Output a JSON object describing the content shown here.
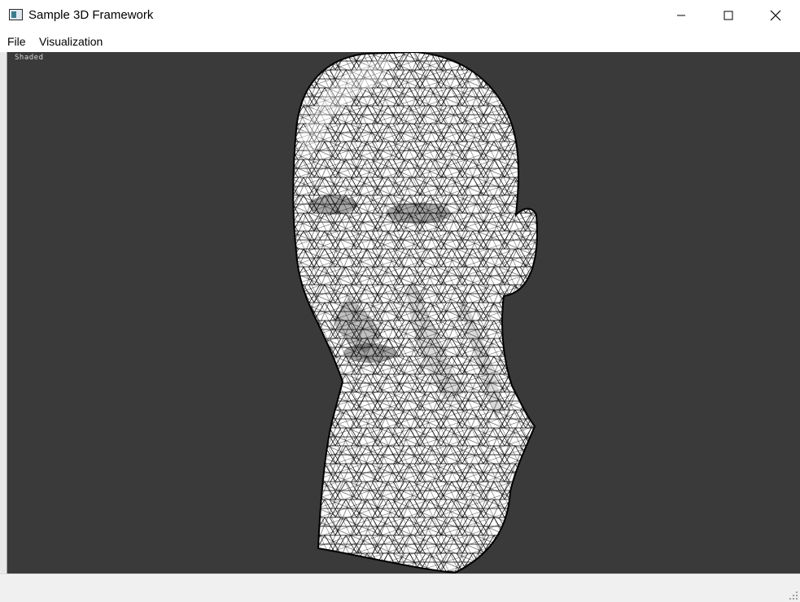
{
  "window": {
    "title": "Sample 3D Framework",
    "icons": {
      "app": "app-window-icon",
      "minimize": "minimize-icon",
      "maximize": "maximize-icon",
      "close": "close-icon"
    }
  },
  "menu": {
    "items": [
      {
        "label": "File"
      },
      {
        "label": "Visualization"
      }
    ]
  },
  "viewport": {
    "overlay_text": "Shaded",
    "background_color": "#3a3a3a",
    "model": "wireframe-head-mesh",
    "mesh_fill_color": "#ffffff",
    "mesh_line_color": "#000000"
  },
  "statusbar": {
    "grip_icon": "size-grip-icon"
  }
}
